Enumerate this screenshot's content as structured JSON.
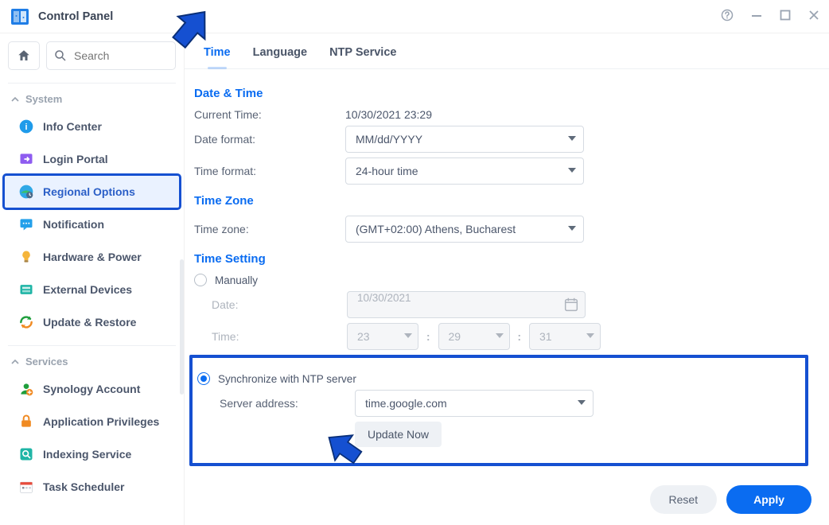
{
  "window": {
    "title": "Control Panel"
  },
  "search": {
    "placeholder": "Search"
  },
  "sections": {
    "system": {
      "label": "System"
    },
    "services": {
      "label": "Services"
    }
  },
  "nav": {
    "system": [
      {
        "label": "Info Center"
      },
      {
        "label": "Login Portal"
      },
      {
        "label": "Regional Options"
      },
      {
        "label": "Notification"
      },
      {
        "label": "Hardware & Power"
      },
      {
        "label": "External Devices"
      },
      {
        "label": "Update & Restore"
      }
    ],
    "services": [
      {
        "label": "Synology Account"
      },
      {
        "label": "Application Privileges"
      },
      {
        "label": "Indexing Service"
      },
      {
        "label": "Task Scheduler"
      }
    ]
  },
  "tabs": {
    "time": "Time",
    "language": "Language",
    "ntp": "NTP Service"
  },
  "dateTime": {
    "title": "Date & Time",
    "currentTimeLabel": "Current Time:",
    "currentTimeValue": "10/30/2021 23:29",
    "dateFormatLabel": "Date format:",
    "dateFormatValue": "MM/dd/YYYY",
    "timeFormatLabel": "Time format:",
    "timeFormatValue": "24-hour time"
  },
  "timeZone": {
    "title": "Time Zone",
    "label": "Time zone:",
    "value": "(GMT+02:00) Athens, Bucharest"
  },
  "timeSetting": {
    "title": "Time Setting",
    "manualLabel": "Manually",
    "dateLabel": "Date:",
    "dateValue": "10/30/2021",
    "timeLabel": "Time:",
    "hour": "23",
    "minute": "29",
    "second": "31",
    "ntpLabel": "Synchronize with NTP server",
    "serverLabel": "Server address:",
    "serverValue": "time.google.com",
    "updateBtn": "Update Now"
  },
  "footer": {
    "reset": "Reset",
    "apply": "Apply"
  }
}
